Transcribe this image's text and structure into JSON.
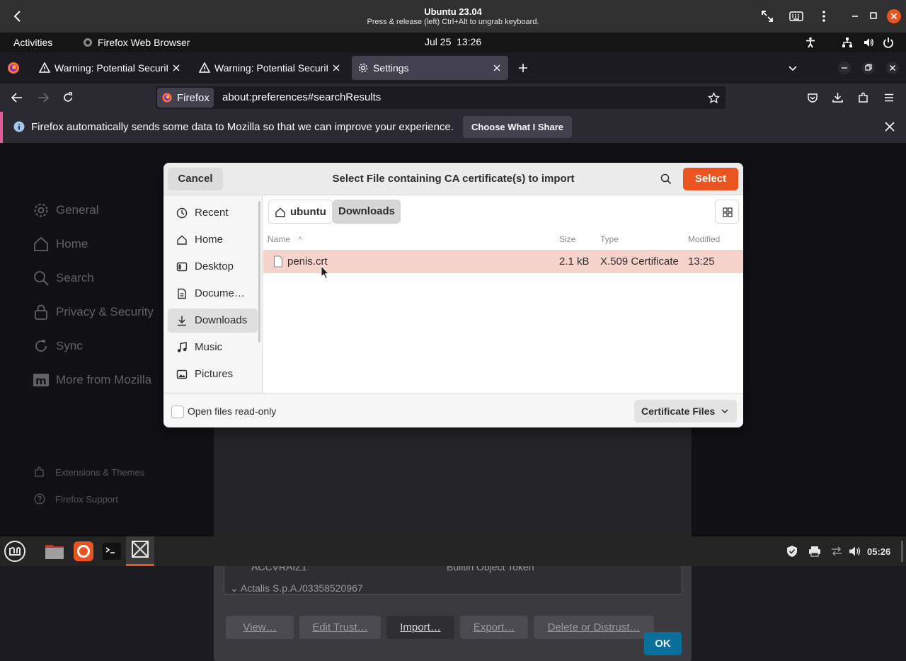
{
  "vm_bar": {
    "title": "Ubuntu 23.04",
    "subtitle": "Press & release (left) Ctrl+Alt to ungrab keyboard."
  },
  "gnome_panel": {
    "activities": "Activities",
    "app_name": "Firefox Web Browser",
    "clock": "Jul 25  13:26"
  },
  "tabs": [
    {
      "label": "Warning: Potential Security Risk Ahead",
      "active": false
    },
    {
      "label": "Warning: Potential Security Risk Ahead",
      "active": false
    },
    {
      "label": "Settings",
      "active": true
    }
  ],
  "urlbar": {
    "identity": "Firefox",
    "url": "about:preferences#searchResults"
  },
  "notification": {
    "message": "Firefox automatically sends some data to Mozilla so that we can improve your experience.",
    "button": "Choose What I Share"
  },
  "settings": {
    "categories": [
      "General",
      "Home",
      "Search",
      "Privacy & Security",
      "Sync",
      "More from Mozilla"
    ],
    "footer": [
      "Extensions & Themes",
      "Firefox Support"
    ]
  },
  "cert_manager": {
    "row_name": "ACCVRAIZ1",
    "row_token": "Builtin Object Token",
    "group": "Actalis S.p.A./03358520967",
    "buttons": {
      "view": "View…",
      "edit": "Edit Trust…",
      "import": "Import…",
      "export": "Export…",
      "delete": "Delete or Distrust…"
    },
    "ok": "OK"
  },
  "chooser": {
    "cancel": "Cancel",
    "title": "Select File containing CA certificate(s) to import",
    "select": "Select",
    "places": [
      {
        "label": "Recent",
        "icon": "clock-icon"
      },
      {
        "label": "Home",
        "icon": "home-icon"
      },
      {
        "label": "Desktop",
        "icon": "desktop-icon"
      },
      {
        "label": "Docume…",
        "icon": "document-icon"
      },
      {
        "label": "Downloads",
        "icon": "download-icon"
      },
      {
        "label": "Music",
        "icon": "music-icon"
      },
      {
        "label": "Pictures",
        "icon": "pictures-icon"
      }
    ],
    "breadcrumb": [
      "ubuntu",
      "Downloads"
    ],
    "columns": {
      "name": "Name",
      "size": "Size",
      "type": "Type",
      "modified": "Modified"
    },
    "files": [
      {
        "name": "penis.crt",
        "size": "2.1 kB",
        "type": "X.509 Certificate",
        "modified": "13:25"
      }
    ],
    "readonly_label": "Open files read-only",
    "filter": "Certificate Files"
  },
  "taskbar": {
    "time": "05:26"
  },
  "colors": {
    "accent": "#e95420",
    "selection": "#f5d3ca",
    "ok_button": "#0b6f9c",
    "notification_stripe": "#e05a9a"
  }
}
